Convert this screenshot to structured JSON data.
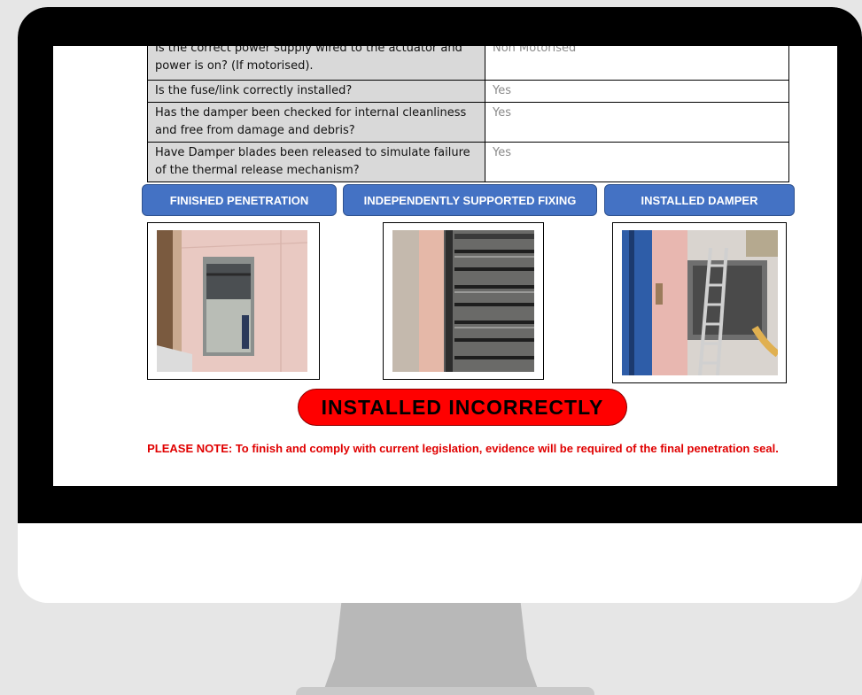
{
  "checklist": [
    {
      "question": "Is the correct power supply wired to the actuator and power is on? (If motorised).",
      "answer": "Non Motorised"
    },
    {
      "question": "Is the fuse/link correctly installed?",
      "answer": "Yes"
    },
    {
      "question": "Has the damper been checked for internal cleanliness and free from damage and debris?",
      "answer": "Yes"
    },
    {
      "question": "Have Damper blades been released to simulate failure of the thermal release mechanism?",
      "answer": "Yes"
    }
  ],
  "photos": {
    "finished_penetration": "FINISHED PENETRATION",
    "supported_fixing": "INDEPENDENTLY SUPPORTED FIXING",
    "installed_damper": "INSTALLED DAMPER"
  },
  "verdict": "INSTALLED  INCORRECTLY",
  "note": "PLEASE NOTE: To finish and comply with current legislation, evidence will be required of the final penetration seal.",
  "colors": {
    "label_blue": "#4472c4",
    "verdict_red": "#ff0000",
    "note_red": "#e00000"
  }
}
